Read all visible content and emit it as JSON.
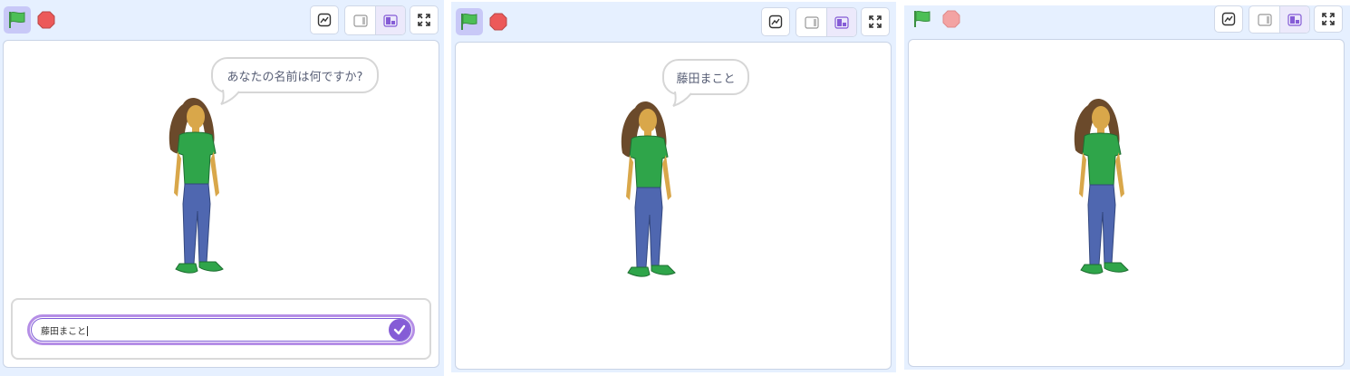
{
  "panels": [
    {
      "id": "stage-1",
      "flag_state": "active",
      "stop_state": "active",
      "speech": "あなたの名前は何ですか?",
      "ask": {
        "value": "藤田まこと",
        "submit_icon": "check-icon"
      }
    },
    {
      "id": "stage-2",
      "flag_state": "active",
      "stop_state": "active",
      "speech": "藤田まこと"
    },
    {
      "id": "stage-3",
      "flag_state": "idle",
      "stop_state": "disabled"
    }
  ],
  "icons": {
    "green_flag": "green-flag-icon",
    "stop": "stop-sign-icon",
    "costume": "costume-editor-icon",
    "small_stage": "small-stage-icon",
    "normal_stage": "normal-stage-icon",
    "fullscreen": "fullscreen-icon"
  },
  "colors": {
    "panel_bg": "#e6f0ff",
    "flag_active_bg": "#c8c8f7",
    "flag_green": "#4cbf56",
    "stop_red": "#ec5959",
    "stop_disabled": "#f3a3a3",
    "ask_border": "#855cd6"
  }
}
